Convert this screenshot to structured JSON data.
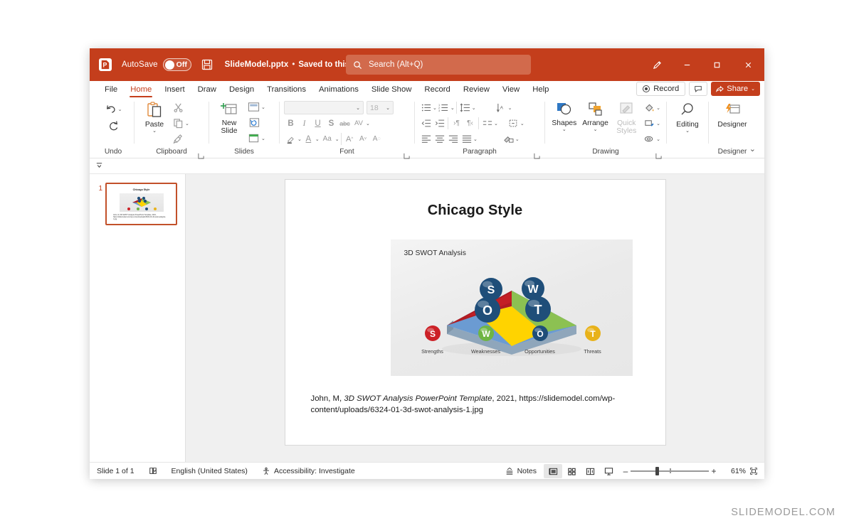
{
  "titlebar": {
    "app_icon": "powerpoint-logo-icon",
    "autosave_label": "AutoSave",
    "autosave_state": "Off",
    "save_icon": "save-icon",
    "document_name": "SlideModel.pptx",
    "separator": "•",
    "save_state": "Saved to this PC",
    "chevron": "⌄",
    "search_placeholder": "Search (Alt+Q)",
    "pen_icon": "pen-draw-icon",
    "minimize": "–",
    "maximize": "□",
    "close": "✕"
  },
  "ribbon_tabs": [
    {
      "label": "File",
      "active": false
    },
    {
      "label": "Home",
      "active": true
    },
    {
      "label": "Insert",
      "active": false
    },
    {
      "label": "Draw",
      "active": false
    },
    {
      "label": "Design",
      "active": false
    },
    {
      "label": "Transitions",
      "active": false
    },
    {
      "label": "Animations",
      "active": false
    },
    {
      "label": "Slide Show",
      "active": false
    },
    {
      "label": "Record",
      "active": false
    },
    {
      "label": "Review",
      "active": false
    },
    {
      "label": "View",
      "active": false
    },
    {
      "label": "Help",
      "active": false
    }
  ],
  "tabstrip_right": {
    "record_label": "Record",
    "comments_icon": "comment-icon",
    "share_label": "Share",
    "share_chevron": "⌄"
  },
  "ribbon_groups": {
    "undo": {
      "label": "Undo",
      "buttons": [
        {
          "name": "undo-icon",
          "chevron": "⌄"
        },
        {
          "name": "redo-icon",
          "chevron": ""
        }
      ]
    },
    "clipboard": {
      "label": "Clipboard",
      "paste_label": "Paste",
      "paste_chevron": "⌄",
      "cut_label": "Cut",
      "copy_label": "Copy",
      "format_painter_label": "Format Painter",
      "dialog_launcher": "dialog-box-launcher"
    },
    "slides": {
      "label": "Slides",
      "new_slide_label": "New Slide",
      "new_slide_chevron": "⌄",
      "layout_label": "Layout",
      "reset_label": "Reset",
      "section_label": "Section"
    },
    "font": {
      "label": "Font",
      "font_name_value": "",
      "font_size_value": "18",
      "bold": "B",
      "italic": "I",
      "underline": "U",
      "shadow": "S",
      "strikethrough": "abc",
      "char_spacing": "AV",
      "text_highlight": "text-highlight-icon",
      "font_color": "A",
      "change_case": "Aa",
      "increase_size": "A",
      "decrease_size": "A",
      "clear_formatting": "clear-formatting-icon",
      "dialog_launcher": "dialog-box-launcher"
    },
    "paragraph": {
      "label": "Paragraph",
      "dialog_launcher": "dialog-box-launcher"
    },
    "drawing": {
      "label": "Drawing",
      "shapes_label": "Shapes",
      "shapes_chevron": "⌄",
      "arrange_label": "Arrange",
      "arrange_chevron": "⌄",
      "quick_styles_label": "Quick Styles",
      "quick_styles_chevron": "⌄",
      "shape_fill": "shape-fill-icon",
      "shape_outline": "shape-outline-icon",
      "shape_effects": "shape-effects-icon",
      "dialog_launcher": "dialog-box-launcher"
    },
    "editing": {
      "label": "",
      "editing_label": "Editing",
      "editing_chevron": "⌄"
    },
    "designer": {
      "label": "Designer",
      "designer_label": "Designer"
    },
    "collapse_ribbon": "⌄"
  },
  "qat_strip": {
    "icon": "quick-access-toolbar-icon"
  },
  "thumbnail_pane": {
    "slides": [
      {
        "number": "1",
        "title": "Chicago Style",
        "caption": "John, M, 3D SWOT Analysis PowerPoint Template, 2021, https://slidemodel.com/wp-content/uploads/6324-01-3d-swot-analysis-1.jpg",
        "selected": true
      }
    ]
  },
  "slide": {
    "title": "Chicago Style",
    "image": {
      "heading": "3D SWOT Analysis",
      "spheres": [
        {
          "letter": "S",
          "color": "#1f4e79"
        },
        {
          "letter": "W",
          "color": "#1f4e79"
        },
        {
          "letter": "O",
          "color": "#1f4e79"
        },
        {
          "letter": "T",
          "color": "#1f4e79"
        }
      ],
      "quadrants": [
        {
          "name": "strengths",
          "color": "#b01c22"
        },
        {
          "name": "weaknesses",
          "color": "#8cc152"
        },
        {
          "name": "opportunities",
          "color": "#6b9bd2"
        },
        {
          "name": "threats",
          "color": "#ffd300"
        }
      ],
      "legend": [
        {
          "letter": "S",
          "label": "Strengths",
          "color": "#cc2127"
        },
        {
          "letter": "W",
          "label": "Weaknesses",
          "color": "#6fb543"
        },
        {
          "letter": "O",
          "label": "Opportunities",
          "color": "#1f4e79"
        },
        {
          "letter": "T",
          "label": "Threats",
          "color": "#e8b21a"
        }
      ]
    },
    "caption_parts": {
      "author": "John, M, ",
      "work_italic": "3D SWOT Analysis PowerPoint Template",
      "rest": ", 2021, https://slidemodel.com/wp-content/uploads/6324-01-3d-swot-analysis-1.jpg"
    }
  },
  "statusbar": {
    "slide_count": "Slide 1 of 1",
    "spellcheck_icon": "spellcheck-icon",
    "language": "English (United States)",
    "accessibility_icon": "accessibility-icon",
    "accessibility": "Accessibility: Investigate",
    "notes_label": "Notes",
    "views": [
      {
        "name": "normal-view",
        "active": true
      },
      {
        "name": "slide-sorter-view",
        "active": false
      },
      {
        "name": "reading-view",
        "active": false
      },
      {
        "name": "slide-show-view",
        "active": false
      }
    ],
    "zoom_out": "–",
    "zoom_in": "+",
    "zoom_level": "61%",
    "fit_to_window": "fit-slide-to-window-icon"
  },
  "watermark": "SLIDEMODEL.COM",
  "colors": {
    "brand": "#c43e1c",
    "search_bg": "#d26a4c",
    "accent_text": "#c43e1c"
  }
}
